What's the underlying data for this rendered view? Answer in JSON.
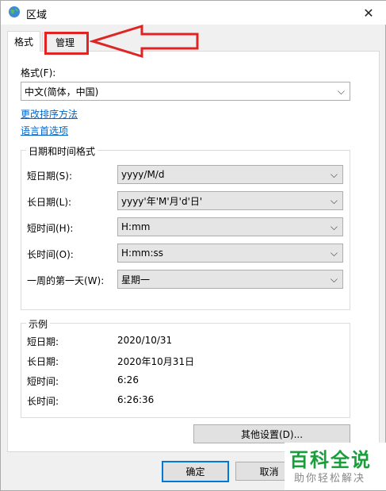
{
  "window": {
    "title": "区域",
    "close_glyph": "✕"
  },
  "tabs": [
    {
      "label": "格式"
    },
    {
      "label": "管理"
    }
  ],
  "format_section": {
    "label": "格式(F):",
    "value": "中文(简体，中国)"
  },
  "links": {
    "change_sort": "更改排序方法",
    "language_pref": "语言首选项"
  },
  "datetime_group": {
    "title": "日期和时间格式",
    "rows": [
      {
        "label": "短日期(S):",
        "value": "yyyy/M/d"
      },
      {
        "label": "长日期(L):",
        "value": "yyyy'年'M'月'd'日'"
      },
      {
        "label": "短时间(H):",
        "value": "H:mm"
      },
      {
        "label": "长时间(O):",
        "value": "H:mm:ss"
      },
      {
        "label": "一周的第一天(W):",
        "value": "星期一"
      }
    ]
  },
  "example_group": {
    "title": "示例",
    "rows": [
      {
        "label": "短日期:",
        "value": "2020/10/31"
      },
      {
        "label": "长日期:",
        "value": "2020年10月31日"
      },
      {
        "label": "短时间:",
        "value": "6:26"
      },
      {
        "label": "长时间:",
        "value": "6:26:36"
      }
    ]
  },
  "buttons": {
    "other_settings": "其他设置(D)...",
    "ok": "确定",
    "cancel": "取消"
  },
  "chevron_glyph": "⌵",
  "watermark": {
    "main": "百科全说",
    "sub": "助你轻松解决"
  },
  "colors": {
    "link": "#0066cc",
    "highlight": "#e02424",
    "primary_border": "#0078d7",
    "watermark": "#1a9e3b"
  }
}
